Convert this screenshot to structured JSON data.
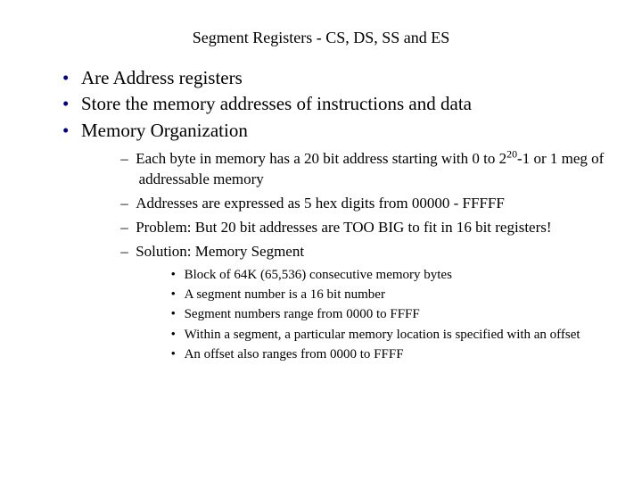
{
  "title": "Segment Registers - CS, DS, SS and ES",
  "bullets": {
    "b0": "Are Address registers",
    "b1": "Store the memory addresses of instructions and data",
    "b2": "Memory Organization"
  },
  "sub": {
    "s0a": "Each byte in memory has a 20 bit address starting with 0 to 2",
    "s0exp": "20",
    "s0b": "-1 or 1 meg of addressable memory",
    "s1": "Addresses are expressed as 5 hex digits from 00000 - FFFFF",
    "s2": "Problem: But 20 bit addresses are TOO BIG to fit in 16 bit registers!",
    "s3": "Solution: Memory Segment"
  },
  "subsub": {
    "t0": "Block of 64K (65,536) consecutive memory bytes",
    "t1": "A segment number is a 16 bit number",
    "t2": "Segment numbers range from 0000 to FFFF",
    "t3": "Within a segment, a particular memory location is specified with an offset",
    "t4": "An offset also ranges from 0000 to FFFF"
  }
}
